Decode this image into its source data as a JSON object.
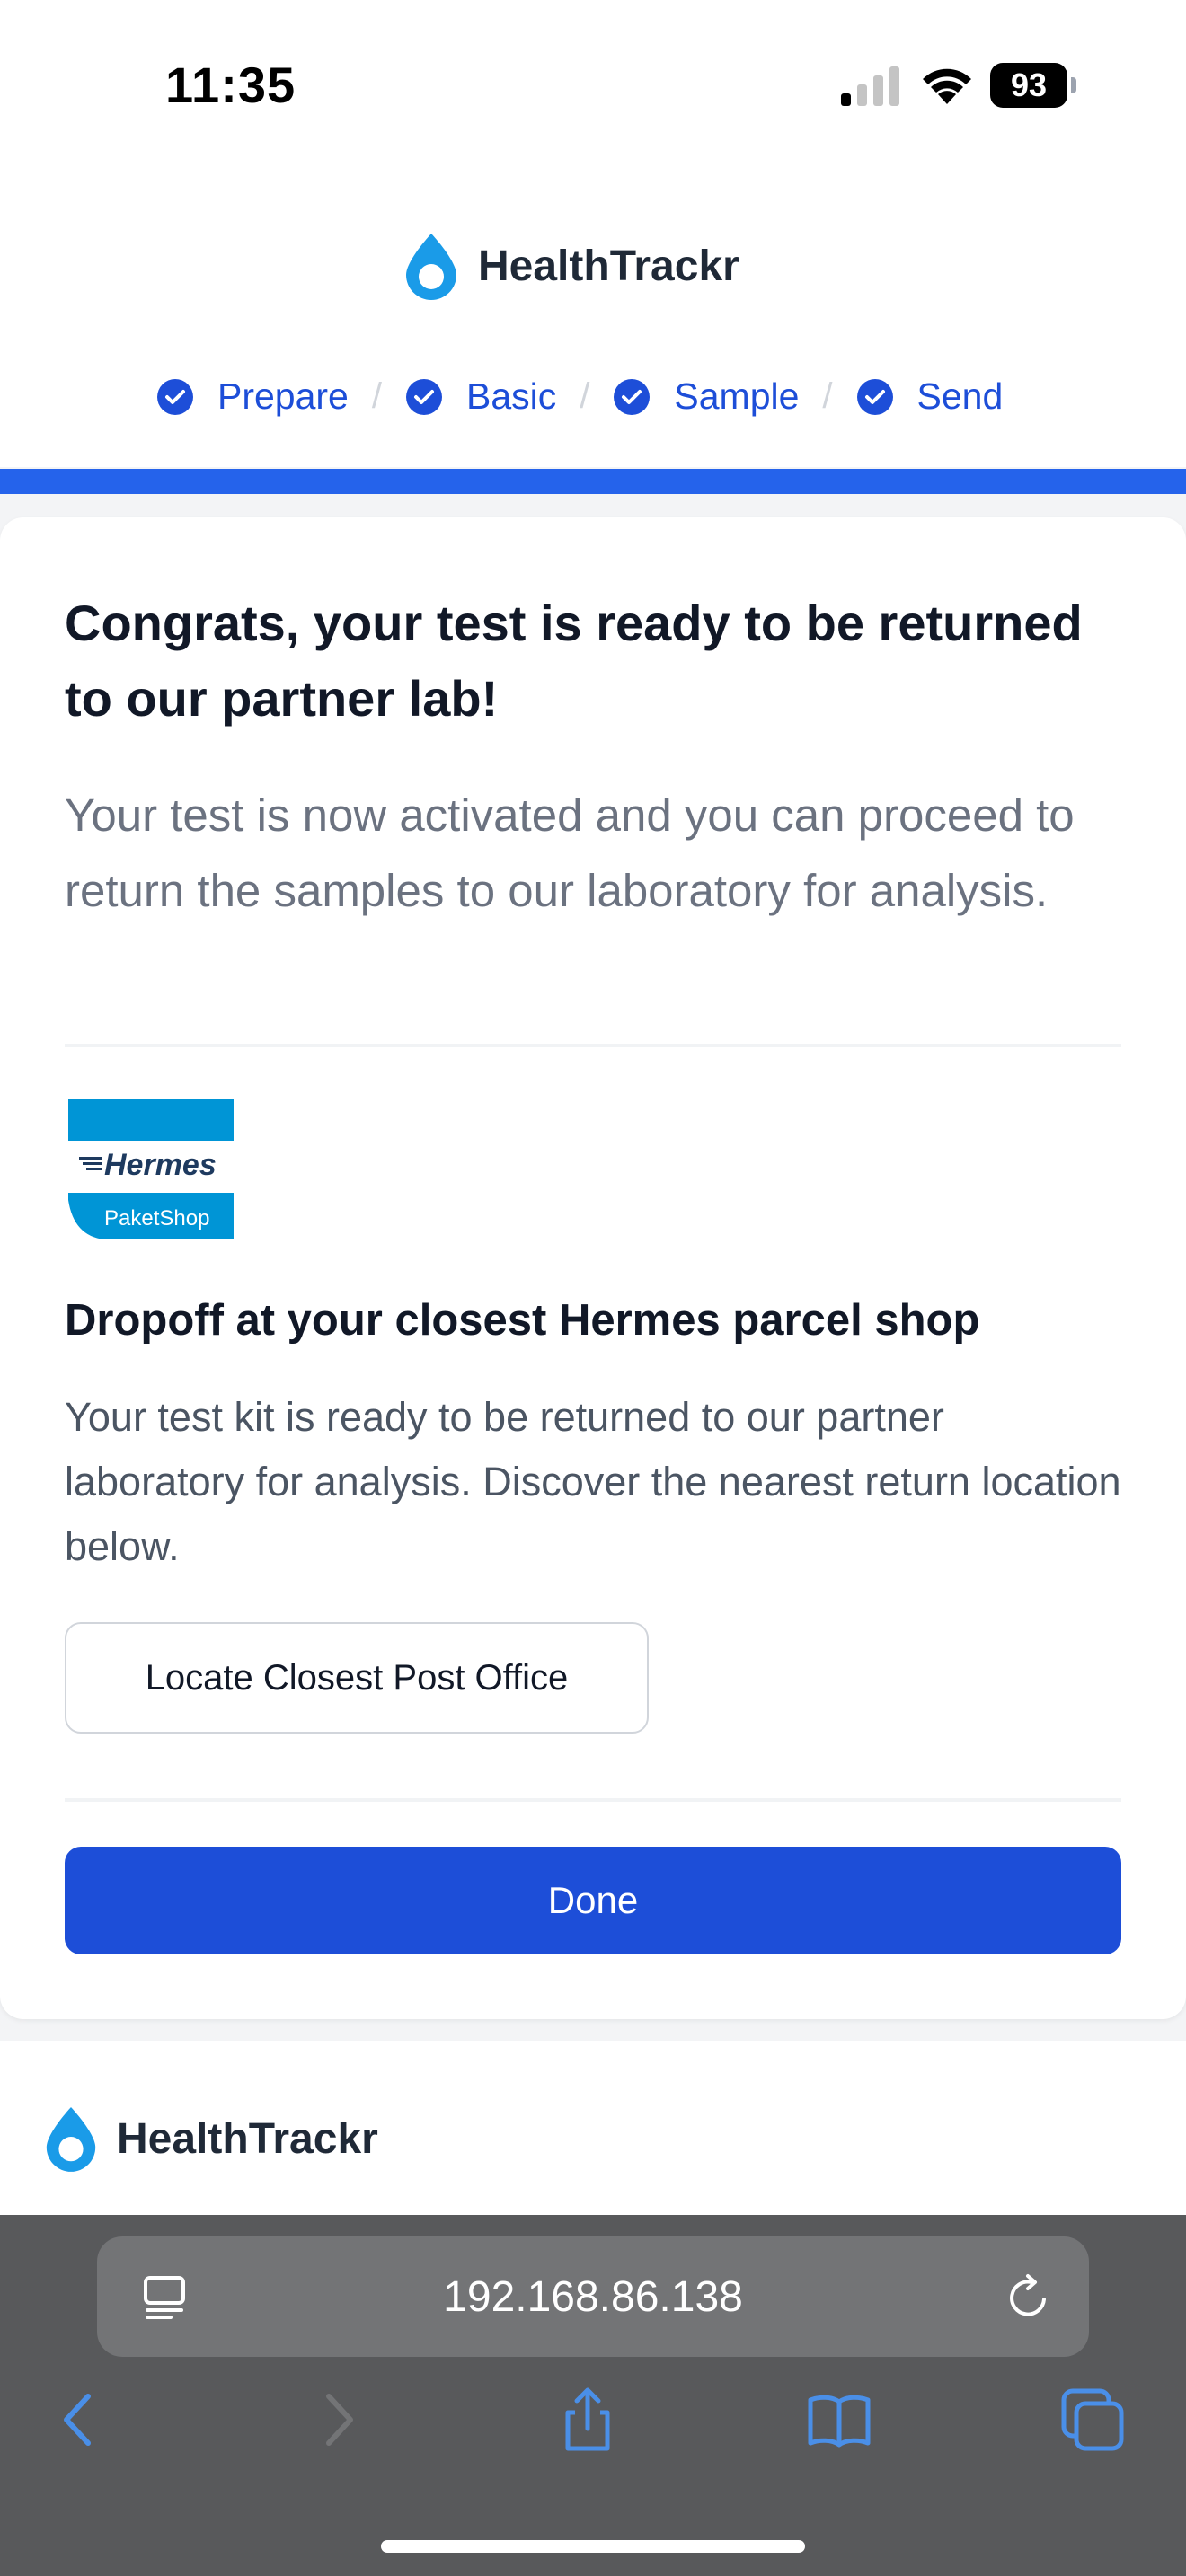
{
  "status_bar": {
    "time": "11:35",
    "battery": "93",
    "icons": [
      "signal-icon",
      "wifi-icon",
      "battery-icon"
    ]
  },
  "header": {
    "brand_name": "HealthTrackr",
    "brand_icon": "droplet-icon",
    "steps": [
      {
        "label": "Prepare",
        "completed": true
      },
      {
        "label": "Basic",
        "completed": true
      },
      {
        "label": "Sample",
        "completed": true
      },
      {
        "label": "Send",
        "completed": true
      }
    ],
    "step_separator": "/",
    "progress": 1.0
  },
  "card": {
    "title": "Congrats, your test is ready to be returned to our partner lab!",
    "subtitle": "Your test is now activated and you can proceed to return the samples to our laboratory for analysis.",
    "carrier_logo": {
      "name": "Hermes",
      "sub": "PaketShop"
    },
    "dropoff_title": "Dropoff at your closest Hermes parcel shop",
    "dropoff_text": "Your test kit is ready to be returned to our partner laboratory for analysis. Discover the nearest return location below.",
    "locate_button": "Locate Closest Post Office",
    "done_button": "Done"
  },
  "footer": {
    "brand_name": "HealthTrackr"
  },
  "browser": {
    "url": "192.168.86.138",
    "icons": [
      "page-menu-icon",
      "reload-icon",
      "back-icon",
      "forward-icon",
      "share-icon",
      "bookmarks-icon",
      "tabs-icon"
    ]
  },
  "colors": {
    "accent": "#1d4ed8",
    "progress": "#2563eb",
    "hermes_blue": "#0095d6",
    "browser_bg": "#58595b"
  }
}
